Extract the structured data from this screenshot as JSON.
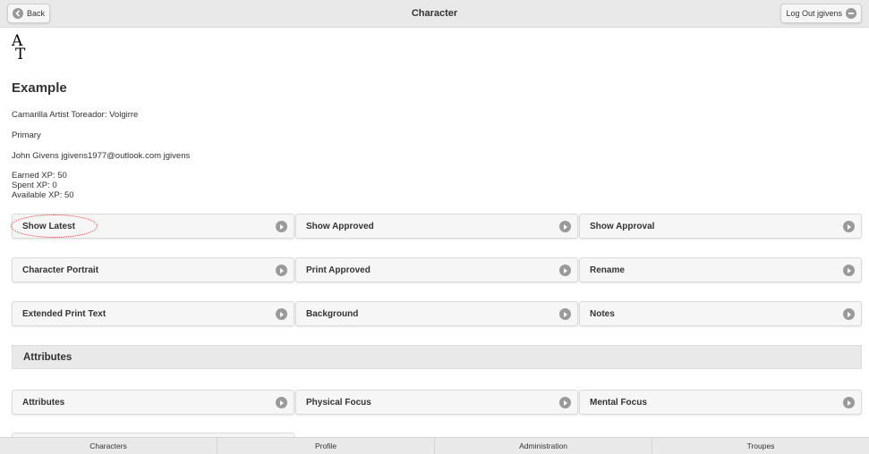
{
  "header": {
    "title": "Character",
    "back_label": "Back",
    "logout_label": "Log Out jgivens"
  },
  "logo": {
    "top": "A",
    "bottom": "T"
  },
  "character": {
    "name": "Example",
    "description": "Camarilla Artist Toreador: Volgirre",
    "status": "Primary",
    "owner": "John Givens jgivens1977@outlook.com jgivens",
    "earned_xp": "Earned XP: 50",
    "spent_xp": "Spent XP: 0",
    "available_xp": "Available XP: 50"
  },
  "actions": [
    [
      "Show Latest",
      "Show Approved",
      "Show Approval"
    ],
    [
      "Character Portrait",
      "Print Approved",
      "Rename"
    ],
    [
      "Extended Print Text",
      "Background",
      "Notes"
    ]
  ],
  "attributes_section": {
    "title": "Attributes",
    "items": [
      "Attributes",
      "Physical Focus",
      "Mental Focus"
    ]
  },
  "footer_tabs": [
    "Characters",
    "Profile",
    "Administration",
    "Troupes"
  ],
  "colors": {
    "header_bg": "#e9e9e9",
    "button_bg": "#f6f6f6",
    "arrow_icon": "#9a9a9a",
    "highlight": "#e0302a"
  }
}
